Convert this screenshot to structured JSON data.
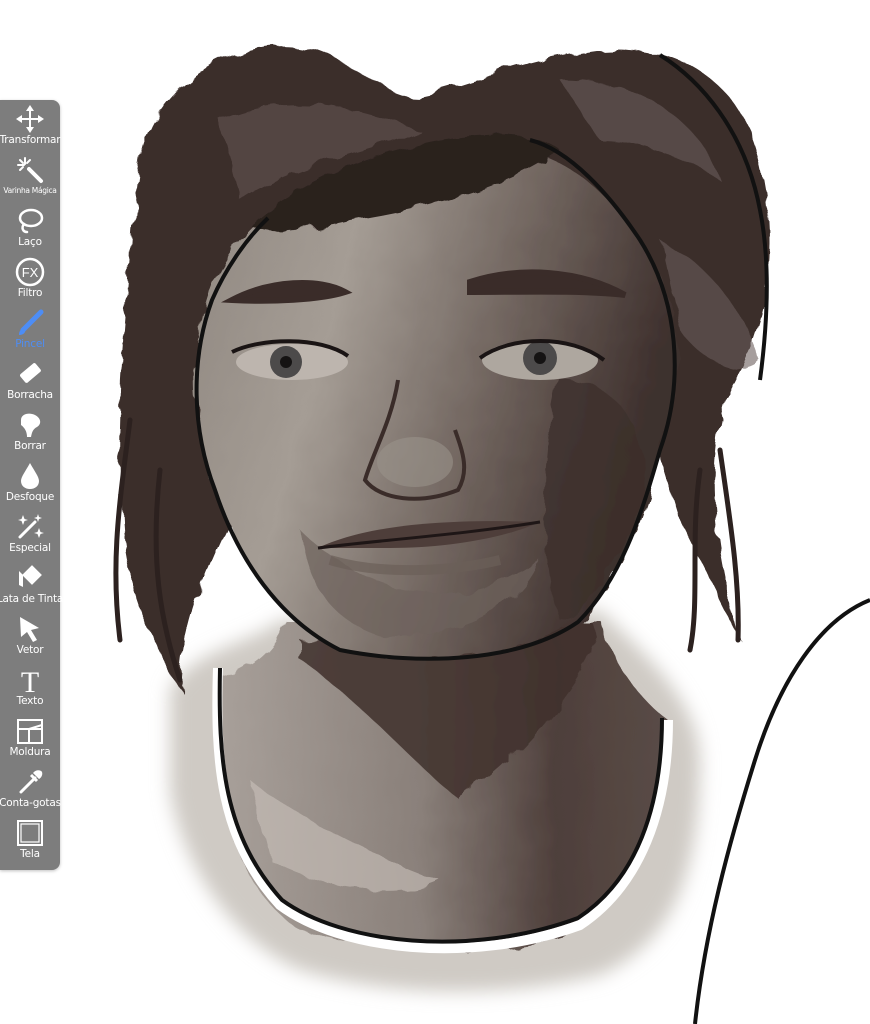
{
  "colors": {
    "toolbar_bg": "#7d7d7d",
    "toolbar_text": "#ffffff",
    "active_tool": "#4d8df5",
    "canvas_bg": "#ffffff",
    "hair": "#3a2d2a",
    "skin_light": "#a39b93",
    "skin_shadow": "#4a3a36",
    "outline": "#111111"
  },
  "toolbar": {
    "active_tool": "Pincel",
    "tools": [
      {
        "id": "transform",
        "label": "Transformar",
        "icon": "move-arrows-icon"
      },
      {
        "id": "magic-wand",
        "label": "Varinha Mágica",
        "icon": "magic-wand-icon"
      },
      {
        "id": "lasso",
        "label": "Laço",
        "icon": "lasso-icon"
      },
      {
        "id": "filter",
        "label": "Filtro",
        "icon": "fx-icon",
        "icon_text": "FX"
      },
      {
        "id": "brush",
        "label": "Pincel",
        "icon": "brush-icon"
      },
      {
        "id": "eraser",
        "label": "Borracha",
        "icon": "eraser-icon"
      },
      {
        "id": "smudge",
        "label": "Borrar",
        "icon": "smudge-finger-icon"
      },
      {
        "id": "blur",
        "label": "Desfoque",
        "icon": "blur-drop-icon"
      },
      {
        "id": "special",
        "label": "Especial",
        "icon": "sparkle-wand-icon"
      },
      {
        "id": "fill",
        "label": "Lata de Tinta",
        "icon": "paint-bucket-icon"
      },
      {
        "id": "vector",
        "label": "Vetor",
        "icon": "cursor-arrow-icon"
      },
      {
        "id": "text",
        "label": "Texto",
        "icon": "text-icon",
        "icon_text": "T"
      },
      {
        "id": "frame",
        "label": "Moldura",
        "icon": "frame-icon"
      },
      {
        "id": "eyedropper",
        "label": "Conta-gotas",
        "icon": "eyedropper-icon"
      },
      {
        "id": "canvas",
        "label": "Tela",
        "icon": "canvas-icon"
      }
    ]
  },
  "canvas": {
    "content": "digital-portrait-painting"
  }
}
